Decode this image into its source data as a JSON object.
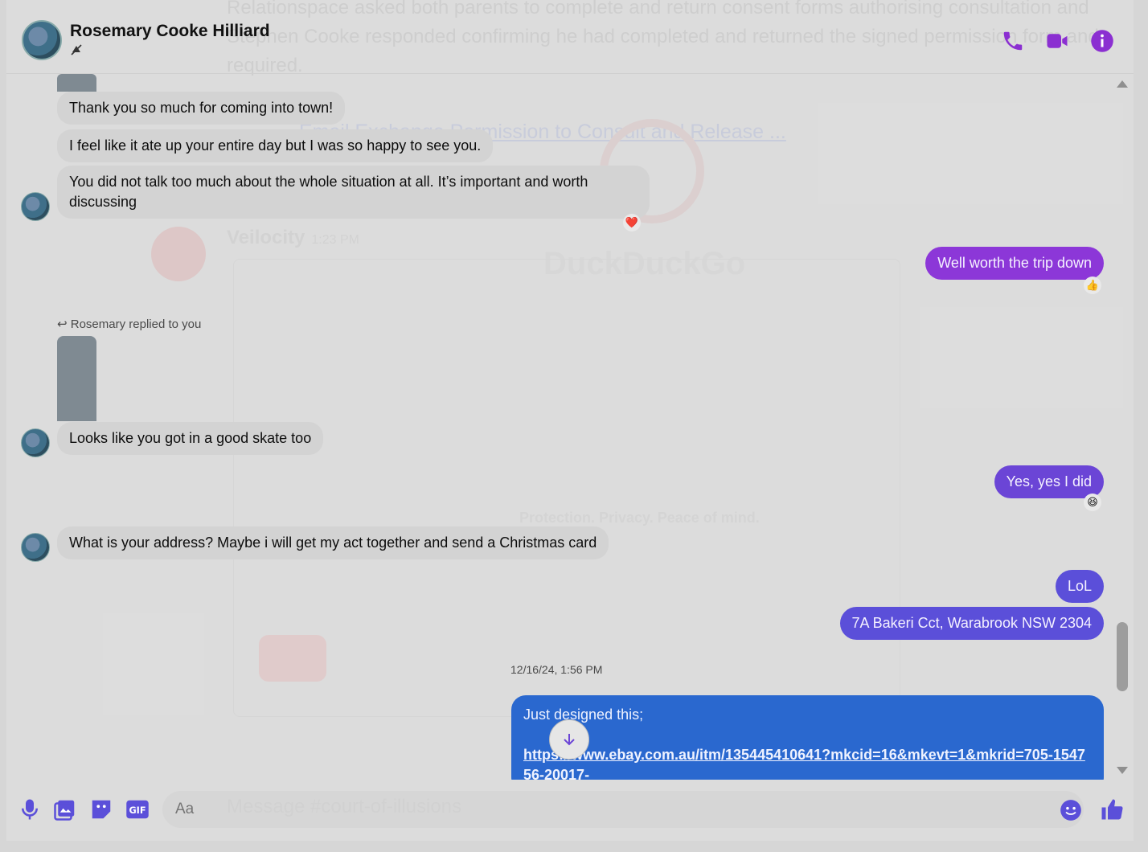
{
  "background": {
    "line1": "Relationspace asked both parents to complete and return consent forms authorising consultation and",
    "line2": "Stephen Cooke responded confirming he had completed and returned the signed permission form and",
    "line3": "required.",
    "attachment_title": "Email Exchange Permission to Consult and Release ...",
    "brand": "DuckDuckGo",
    "tagline": "Protection. Privacy. Peace of mind.",
    "channel_user": "Veilocity",
    "channel_time": "1:23 PM",
    "compose_placeholder": "Message #court-of-illusions"
  },
  "header": {
    "contact_name": "Rosemary Cooke Hilliard",
    "accent_color": "#8b2fd1"
  },
  "messages": {
    "in1": "Thank you so much for coming into town!",
    "in2": "I feel like it ate up your entire day but I was so happy to see you.",
    "in3": "You did not talk too much about the whole situation at all. It’s important and worth discussing",
    "out1": "Well worth the trip down",
    "replied_label": "Rosemary replied to you",
    "in4": "Looks like you got in a good skate too",
    "out2": "Yes, yes I did",
    "in5": "What is your address? Maybe i will get my act together and send a Christmas card",
    "out3": "LoL",
    "out4": "7A Bakeri Cct, Warabrook NSW 2304",
    "timestamp": "12/16/24, 1:56 PM",
    "link_intro": "Just designed this;",
    "link_url": "https://www.ebay.com.au/itm/135445410641?mkcid=16&mkevt=1&mkrid=705-154756-20017-"
  },
  "reactions": {
    "in3": "❤️",
    "out1": "👍",
    "out2": "😆"
  },
  "composer": {
    "placeholder": "Aa"
  }
}
